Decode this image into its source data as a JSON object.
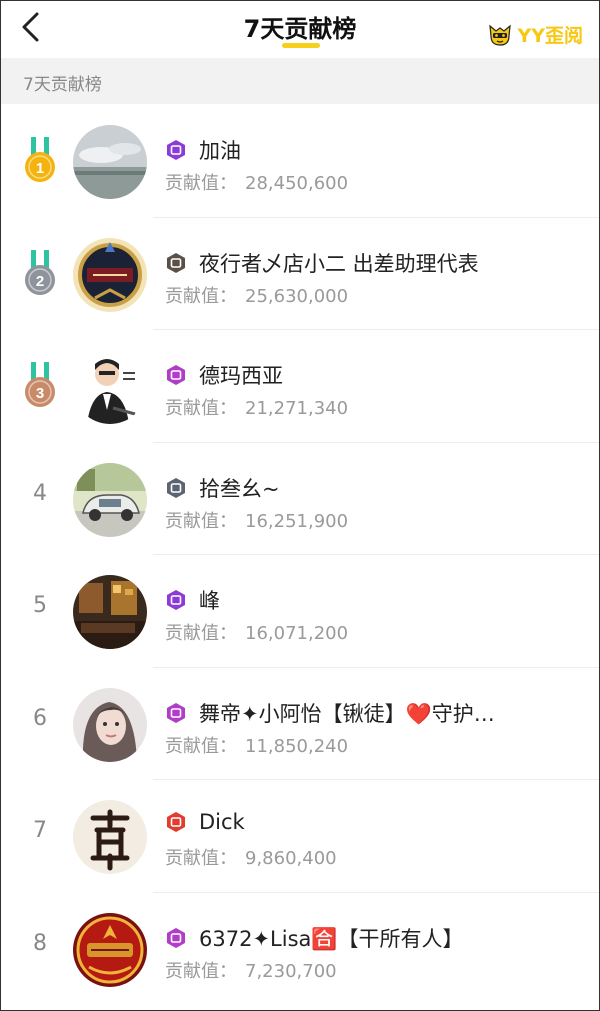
{
  "header": {
    "title": "7天贡献榜",
    "brand": "YY歪阅"
  },
  "section": {
    "label": "7天贡献榜"
  },
  "contrib_label": "贡献值：",
  "colors": {
    "accent": "#f8cf1b",
    "gold": "#f5b30f",
    "silver": "#8f949c",
    "bronze": "#c98a6a",
    "badge_purple": "#8d3bd8",
    "badge_red": "#e23b2f",
    "badge_slate": "#5b6470"
  },
  "entries": [
    {
      "rank": "1",
      "medal": "gold",
      "badge": "公",
      "badge_color": "#8d3bd8",
      "name": "加油",
      "value": "28,450,600",
      "avatar": "cloudy-sky"
    },
    {
      "rank": "2",
      "medal": "silver",
      "badge": "骑",
      "badge_color": "#5b5048",
      "name": "夜行者乄店小二 出差助理代表",
      "value": "25,630,000",
      "avatar": "night-emblem"
    },
    {
      "rank": "3",
      "medal": "bronze",
      "badge": "侯",
      "badge_color": "#b13cc8",
      "name": "德玛西亚",
      "value": "21,271,340",
      "avatar": "cartoon-man"
    },
    {
      "rank": "4",
      "medal": "",
      "badge": "伯",
      "badge_color": "#5b6470",
      "name": "拾叁幺~",
      "value": "16,251,900",
      "avatar": "car-street"
    },
    {
      "rank": "5",
      "medal": "",
      "badge": "公",
      "badge_color": "#8d3bd8",
      "name": "峰",
      "value": "16,071,200",
      "avatar": "dark-room"
    },
    {
      "rank": "6",
      "medal": "",
      "badge": "侯",
      "badge_color": "#b13cc8",
      "name": "舞帝✦小阿怡【锹徒】❤️守护…",
      "value": "11,850,240",
      "avatar": "woman-portrait"
    },
    {
      "rank": "7",
      "medal": "",
      "badge": "王",
      "badge_color": "#e23b2f",
      "name": "Dick",
      "value": "9,860,400",
      "avatar": "calligraphy"
    },
    {
      "rank": "8",
      "medal": "",
      "badge": "侯",
      "badge_color": "#b13cc8",
      "name": "6372✦Lisa🈴【干所有人】",
      "value": "7,230,700",
      "avatar": "lisa-emblem"
    }
  ]
}
